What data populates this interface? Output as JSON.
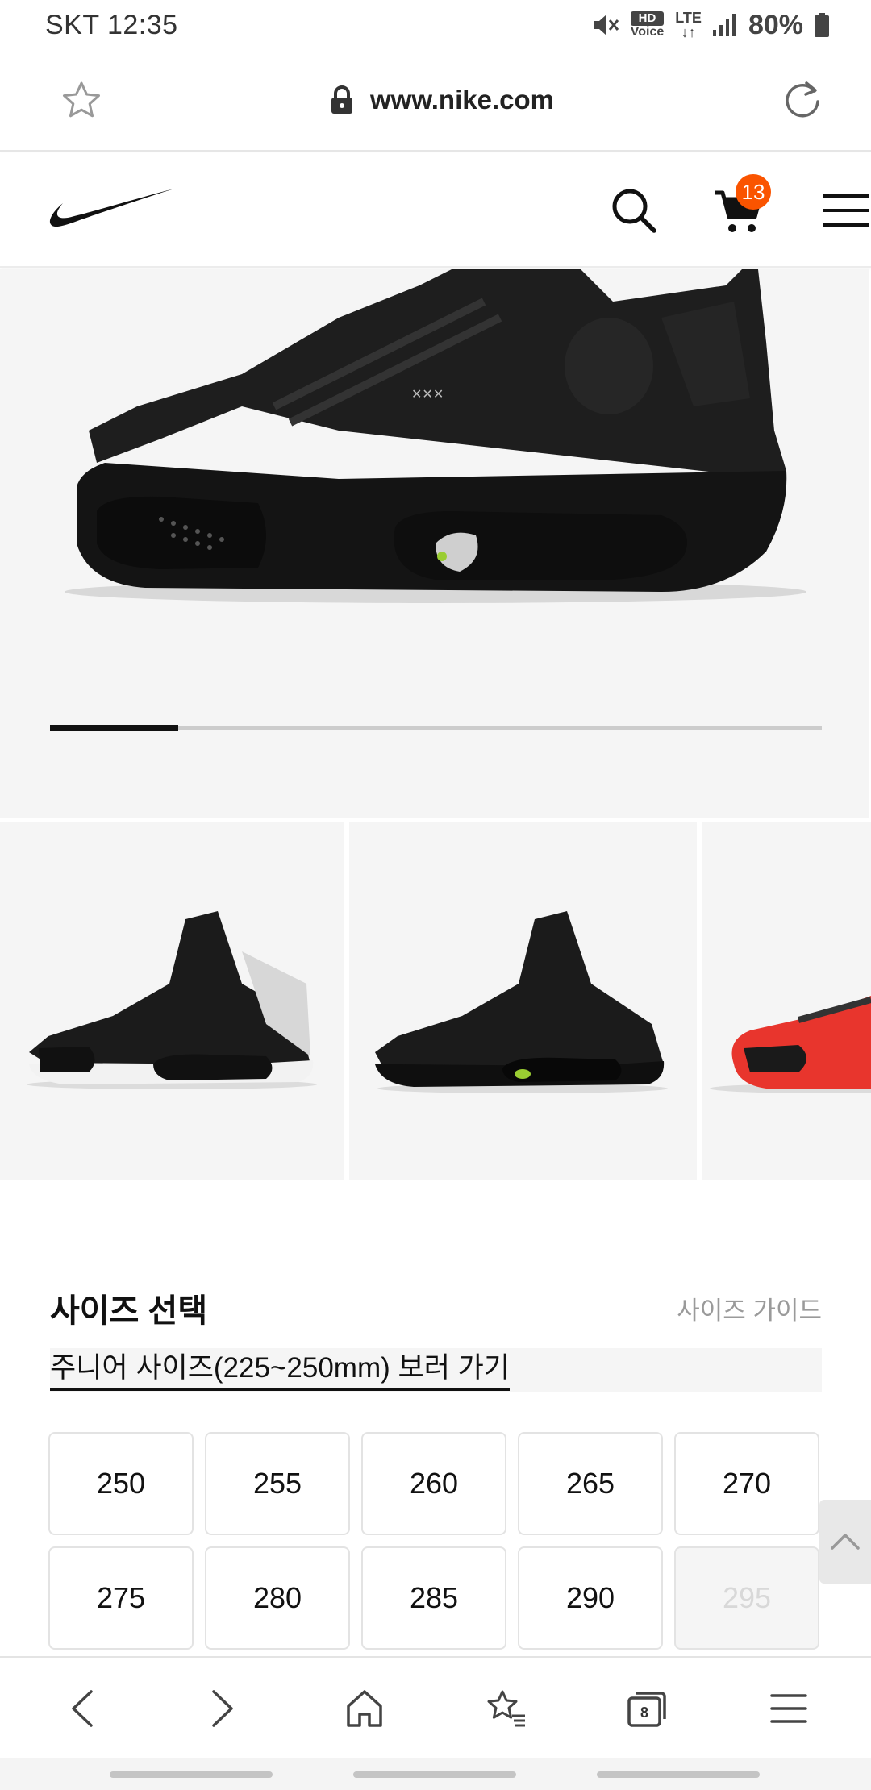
{
  "status_bar": {
    "carrier_time": "SKT 12:35",
    "hd_label": "HD",
    "voice_label": "Voice",
    "lte_label": "LTE",
    "battery": "80%"
  },
  "browser": {
    "url": "www.nike.com",
    "tab_count": "8"
  },
  "header": {
    "cart_count": "13"
  },
  "carousel": {
    "progress": 0.166
  },
  "size_section": {
    "title": "사이즈 선택",
    "guide_link": "사이즈 가이드",
    "junior_link": "주니어 사이즈(225~250mm) 보러 가기",
    "sizes": [
      {
        "label": "250",
        "available": true
      },
      {
        "label": "255",
        "available": true
      },
      {
        "label": "260",
        "available": true
      },
      {
        "label": "265",
        "available": true
      },
      {
        "label": "270",
        "available": true
      },
      {
        "label": "275",
        "available": true
      },
      {
        "label": "280",
        "available": true
      },
      {
        "label": "285",
        "available": true
      },
      {
        "label": "290",
        "available": true
      },
      {
        "label": "295",
        "available": false
      }
    ]
  },
  "colors": {
    "accent": "#fa5400",
    "shoe_black": "#1b1b1b",
    "shoe_red": "#e8352d"
  }
}
